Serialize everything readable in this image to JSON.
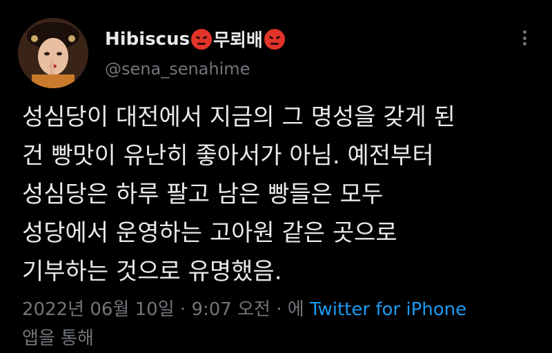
{
  "author": {
    "display_name": "Hibiscus",
    "display_name_suffix": "무뢰배",
    "emoji_icon": "angry-face-icon",
    "handle": "@sena_senahime"
  },
  "tweet": {
    "lines": [
      "성심당이 대전에서 지금의 그 명성을 갖게 된",
      "건 빵맛이 유난히 좋아서가 아님. 예전부터",
      "성심당은 하루 팔고 남은 빵들은 모두",
      "성당에서 운영하는 고아원 같은 곳으로",
      "기부하는 것으로 유명했음."
    ]
  },
  "meta": {
    "date": "2022년 06월 10일",
    "sep1": " · ",
    "time": "9:07 오전",
    "sep2": " · ",
    "via_prefix": "에 ",
    "source": "Twitter for iPhone",
    "via_suffix": "앱을 통해"
  },
  "colors": {
    "background": "#000000",
    "text": "#e7e9ea",
    "muted": "#71767b",
    "link": "#1d9bf0"
  }
}
